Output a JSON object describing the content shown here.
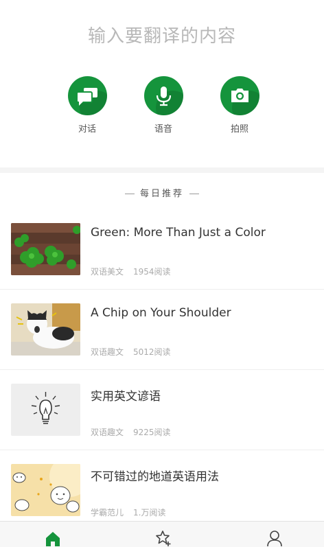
{
  "header": {
    "input_placeholder": "输入要翻译的内容"
  },
  "modes": [
    {
      "label": "对话",
      "icon": "chat-bubbles-icon"
    },
    {
      "label": "语音",
      "icon": "microphone-icon"
    },
    {
      "label": "拍照",
      "icon": "camera-icon"
    }
  ],
  "recommend": {
    "heading": "每日推荐",
    "articles": [
      {
        "title": "Green: More Than Just a Color",
        "category": "双语美文",
        "reads": "1954阅读",
        "image": "clover-photo"
      },
      {
        "title": "A Chip on Your Shoulder",
        "category": "双语趣文",
        "reads": "5012阅读",
        "image": "cat-photo"
      },
      {
        "title": "实用英文谚语",
        "category": "双语趣文",
        "reads": "9225阅读",
        "image": "lightbulb-illustration"
      },
      {
        "title": "不可错过的地道英语用法",
        "category": "学霸范儿",
        "reads": "1.万阅读",
        "image": "cartoon-illustration"
      }
    ]
  },
  "tabbar": {
    "tabs": [
      {
        "icon": "home-icon",
        "active": true
      },
      {
        "icon": "star-add-icon",
        "active": false
      },
      {
        "icon": "user-icon",
        "active": false
      }
    ]
  },
  "colors": {
    "accent": "#15943c",
    "placeholder": "#b8b8b8",
    "meta": "#aaaaaa",
    "background": "#f4f4f4"
  }
}
